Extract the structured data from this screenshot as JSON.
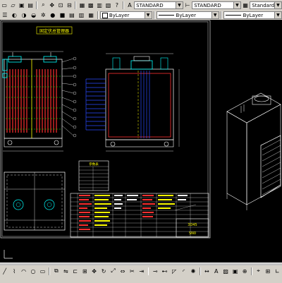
{
  "toolbar": {
    "text_style": "STANDARD",
    "dim_style": "STANDARD",
    "table_style": "Standard",
    "layer_color": "ByLayer",
    "linetype": "ByLayer",
    "lineweight": "ByLayer",
    "icons_row1": [
      "new-icon",
      "open-icon",
      "save-icon",
      "print-icon",
      "zoom-icon",
      "pan-icon",
      "layers-icon",
      "properties-icon",
      "matchprop-icon",
      "design-center-icon",
      "tool-palette-icon",
      "sheet-icon",
      "markup-icon",
      "calc-icon",
      "help-icon"
    ],
    "icons_row2": [
      "layer-state-icon",
      "layer-prev-icon",
      "layer-manager-icon",
      "color-icon",
      "linetype-icon",
      "lineweight-icon"
    ]
  },
  "drawing": {
    "title_label": "固定伏总管理器",
    "title_block_small": "3D45",
    "title_block_big": "SN0",
    "table_header": "参数表"
  },
  "colors": {
    "canvas_bg": "#000000",
    "line_red": "#ff3030",
    "line_yellow": "#ffff00",
    "line_cyan": "#00ffff",
    "line_blue": "#2a4bff",
    "line_white": "#ffffff",
    "line_green": "#00ff00",
    "line_magenta": "#ff40ff"
  },
  "bottom_toolbar": {
    "icons": [
      "line-icon",
      "polyline-icon",
      "arc-icon",
      "circle-icon",
      "rectangle-icon",
      "copy-icon",
      "mirror-icon",
      "offset-icon",
      "array-icon",
      "move-icon",
      "rotate-icon",
      "scale-icon",
      "stretch-icon",
      "trim-icon",
      "extend-icon",
      "break-icon",
      "join-icon",
      "chamfer-icon",
      "fillet-icon",
      "explode-icon",
      "dimension-icon",
      "text-icon",
      "hatch-icon",
      "block-icon",
      "insert-icon",
      "snap-icon",
      "grid-icon",
      "ortho-icon",
      "polar-icon",
      "osnap-icon"
    ]
  }
}
